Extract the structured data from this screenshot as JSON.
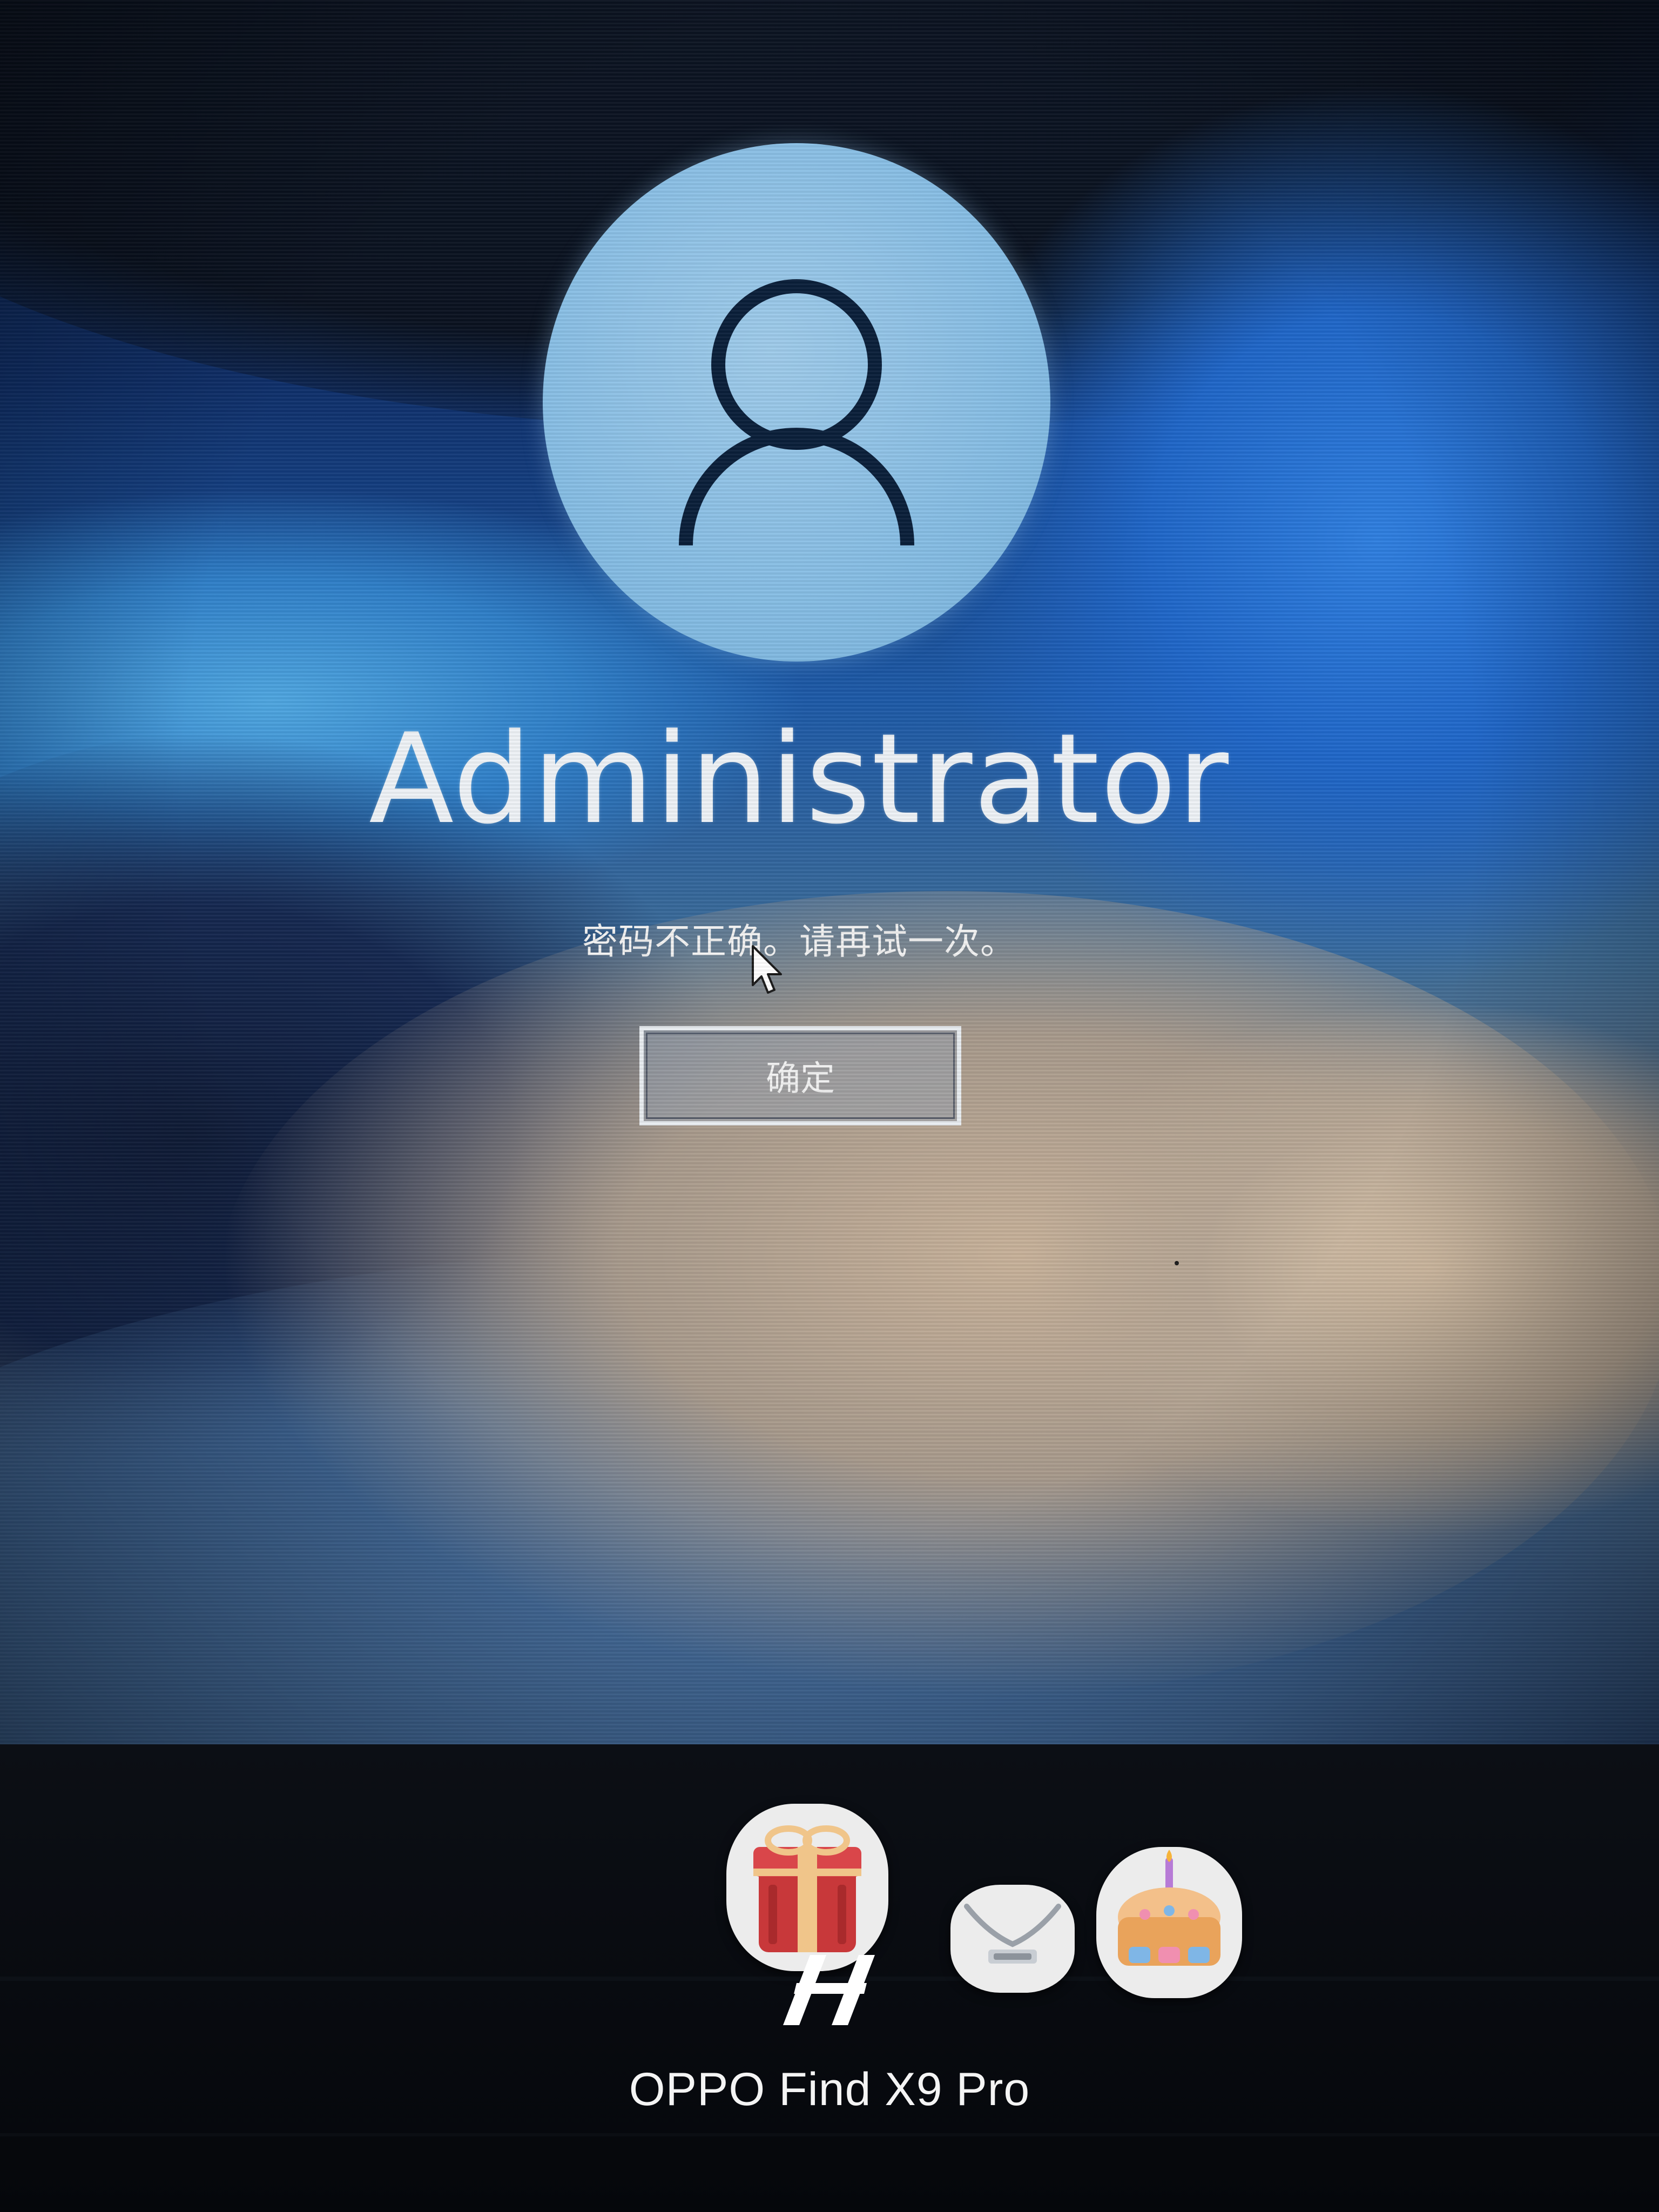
{
  "login_screen": {
    "username": "Administrator",
    "error_message": "密码不正确。请再试一次。",
    "ok_button_label": "确定",
    "avatar_icon": "user-avatar-icon",
    "cursor_icon": "mouse-pointer-icon"
  },
  "photo_overlay": {
    "camera_watermark": "OPPO Find X9 Pro",
    "watermark_logo": "hasselblad-h-logo",
    "stickers": [
      "gift-box-sticker",
      "soul-sticker",
      "birthday-cake-sticker"
    ]
  },
  "colors": {
    "avatar_fill": "#86bde4",
    "avatar_glyph": "#0b1f3a",
    "text": "#eef2f6",
    "button_border": "#e8ecf0"
  }
}
